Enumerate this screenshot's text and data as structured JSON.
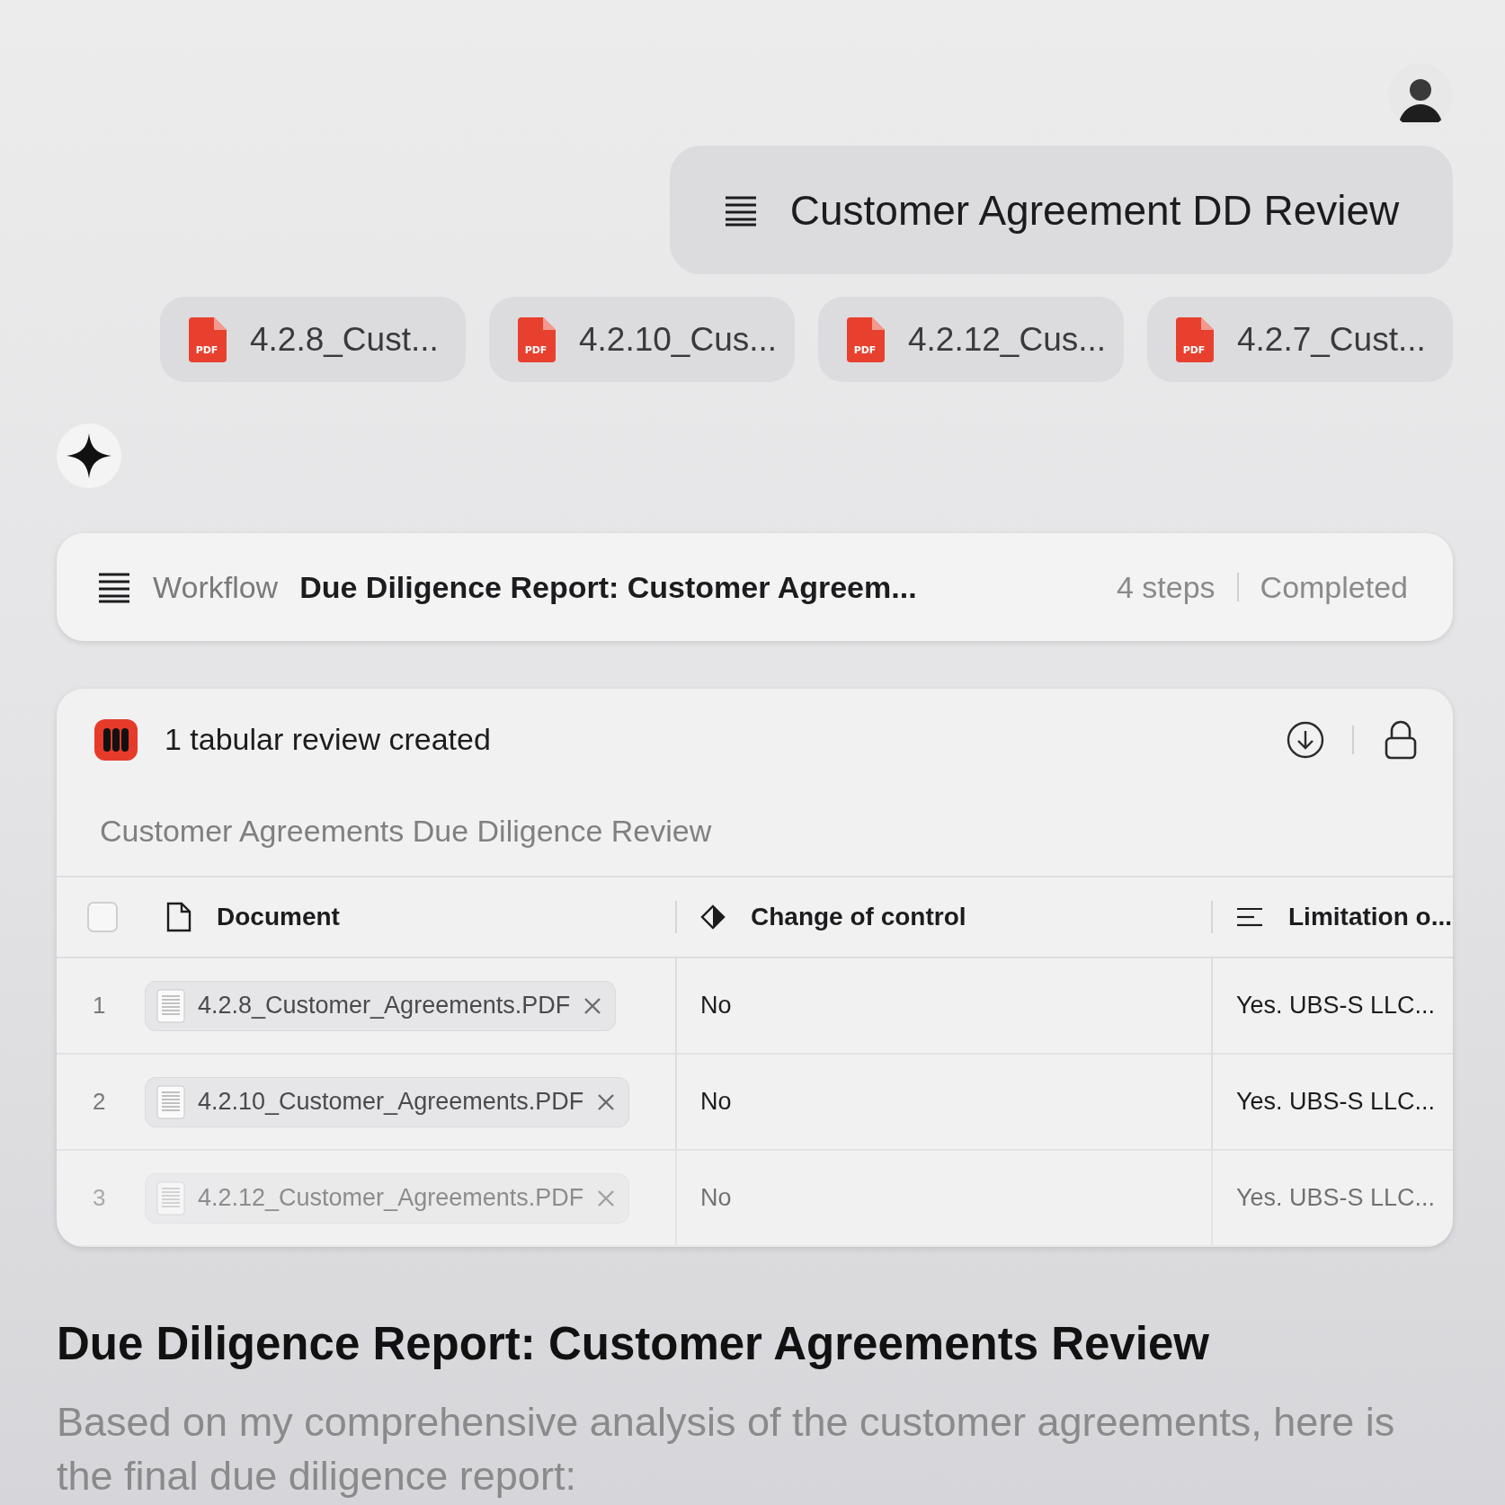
{
  "thread_title": "Customer Agreement DD Review",
  "attachments": [
    {
      "label": "4.2.8_Cust...",
      "badge": "PDF"
    },
    {
      "label": "4.2.10_Cus...",
      "badge": "PDF"
    },
    {
      "label": "4.2.12_Cus...",
      "badge": "PDF"
    },
    {
      "label": "4.2.7_Cust...",
      "badge": "PDF"
    }
  ],
  "workflow": {
    "label": "Workflow",
    "name": "Due Diligence Report: Customer Agreem...",
    "steps": "4 steps",
    "status": "Completed"
  },
  "review_card": {
    "title": "1 tabular review created",
    "subtitle": "Customer Agreements Due Diligence Review",
    "select_all": {
      "checked": false
    },
    "columns": [
      {
        "kind": "document",
        "label": "Document"
      },
      {
        "kind": "choice",
        "label": "Change of control"
      },
      {
        "kind": "text",
        "label": "Limitation o..."
      }
    ],
    "rows": [
      {
        "number": "1",
        "document": "4.2.8_Customer_Agreements.PDF",
        "change_of_control": "No",
        "limitation": "Yes. UBS-S LLC...",
        "faded": false
      },
      {
        "number": "2",
        "document": "4.2.10_Customer_Agreements.PDF",
        "change_of_control": "No",
        "limitation": "Yes. UBS-S LLC...",
        "faded": false
      },
      {
        "number": "3",
        "document": "4.2.12_Customer_Agreements.PDF",
        "change_of_control": "No",
        "limitation": "Yes. UBS-S LLC...",
        "faded": true
      }
    ]
  },
  "report": {
    "heading": "Due Diligence Report: Customer Agreements Review",
    "body": "Based on my comprehensive analysis of the customer agreements, here is the final due diligence report:"
  }
}
